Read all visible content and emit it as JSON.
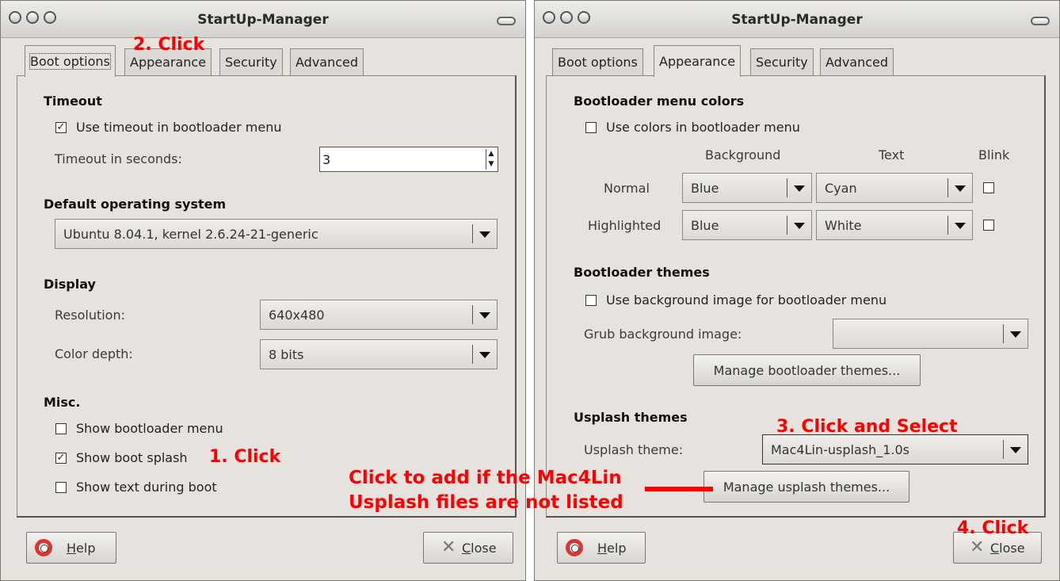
{
  "window_title": "StartUp-Manager",
  "tabs": [
    "Boot options",
    "Appearance",
    "Security",
    "Advanced"
  ],
  "left": {
    "timeout": {
      "header": "Timeout",
      "use_timeout_label": "Use timeout in bootloader menu",
      "use_timeout_checked": true,
      "seconds_label": "Timeout in seconds:",
      "seconds_value": "3"
    },
    "default_os": {
      "header": "Default operating system",
      "value": "Ubuntu 8.04.1, kernel 2.6.24-21-generic"
    },
    "display": {
      "header": "Display",
      "resolution_label": "Resolution:",
      "resolution_value": "640x480",
      "depth_label": "Color depth:",
      "depth_value": "8 bits"
    },
    "misc": {
      "header": "Misc.",
      "show_menu_label": "Show bootloader menu",
      "show_menu_checked": false,
      "show_splash_label": "Show boot splash",
      "show_splash_checked": true,
      "show_text_label": "Show text during boot",
      "show_text_checked": false
    }
  },
  "right": {
    "colors": {
      "header": "Bootloader menu colors",
      "use_colors_label": "Use colors in bootloader menu",
      "use_colors_checked": false,
      "col_background": "Background",
      "col_text": "Text",
      "col_blink": "Blink",
      "normal_label": "Normal",
      "normal_bg": "Blue",
      "normal_text": "Cyan",
      "highlighted_label": "Highlighted",
      "highlighted_bg": "Blue",
      "highlighted_text": "White"
    },
    "themes": {
      "header": "Bootloader themes",
      "use_bg_label": "Use background image for bootloader menu",
      "use_bg_checked": false,
      "grub_label": "Grub background image:",
      "grub_value": "",
      "manage_label": "Manage bootloader themes..."
    },
    "usplash": {
      "header": "Usplash themes",
      "theme_label": "Usplash theme:",
      "theme_value": "Mac4Lin-usplash_1.0s",
      "manage_label": "Manage usplash themes..."
    }
  },
  "buttons": {
    "help_accel": "H",
    "help_rest": "elp",
    "close_accel": "C",
    "close_rest": "lose"
  },
  "annotations": {
    "step1": "1. Click",
    "step2": "2. Click",
    "step3": "3. Click and Select",
    "step4": "4. Click",
    "note_line1": "Click to add if the Mac4Lin",
    "note_line2": "Usplash files are not listed"
  },
  "colors": {
    "annotation": "#ff0000",
    "window_bg": "#e6e3df"
  }
}
